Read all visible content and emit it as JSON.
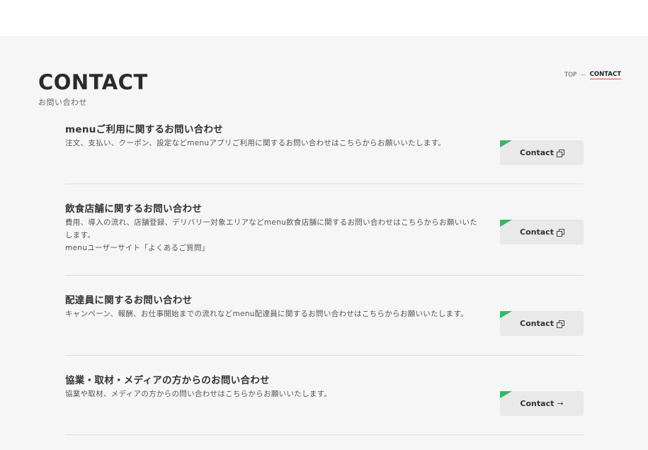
{
  "page": {
    "title": "CONTACT",
    "subtitle": "お問い合わせ"
  },
  "breadcrumb": {
    "top": "TOP",
    "separator": "—",
    "current": "CONTACT"
  },
  "colors": {
    "accent_green": "#3db36a",
    "breadcrumb_underline": "#e8433e",
    "section_background": "#f6f6f6"
  },
  "sections": [
    {
      "title": "menuご利用に関するお問い合わせ",
      "description": [
        "注文、支払い、クーポン、設定などmenuアプリご利用に関するお問い合わせはこちらからお願いいたします。"
      ],
      "button_label": "Contact",
      "button_icon": "external-link-icon"
    },
    {
      "title": "飲食店舗に関するお問い合わせ",
      "description": [
        "費用、導入の流れ、店舗登録、デリバリー対象エリアなどmenu飲食店舗に関するお問い合わせはこちらからお願いいたします。",
        "menuユーザーサイト「よくあるご質問」"
      ],
      "button_label": "Contact",
      "button_icon": "external-link-icon"
    },
    {
      "title": "配達員に関するお問い合わせ",
      "description": [
        "キャンペーン、報酬、お仕事開始までの流れなどmenu配達員に関するお問い合わせはこちらからお願いいたします。"
      ],
      "button_label": "Contact",
      "button_icon": "external-link-icon"
    },
    {
      "title": "協業・取材・メディアの方からのお問い合わせ",
      "description": [
        "協業や取材、メディアの方からの問い合わせはこちらからお願いいたします。"
      ],
      "button_label": "Contact",
      "button_icon": "arrow-right-icon",
      "button_arrow": "→"
    }
  ]
}
